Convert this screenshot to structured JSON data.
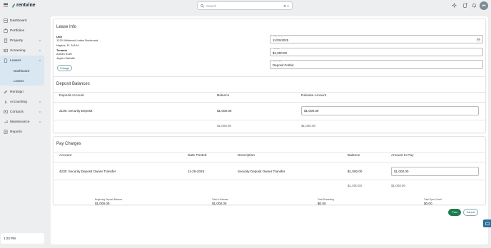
{
  "app": {
    "brand": "rentvine",
    "avatar_initials": "MH"
  },
  "search": {
    "placeholder": "Search",
    "shortcut": "⌘ K"
  },
  "sidebar": {
    "items": [
      {
        "label": "Dashboard",
        "icon": "dashboard-icon"
      },
      {
        "label": "Portfolios",
        "icon": "portfolio-icon"
      },
      {
        "label": "Property",
        "icon": "building-icon"
      },
      {
        "label": "Screening",
        "icon": "screening-icon"
      },
      {
        "label": "Leases",
        "icon": "leases-icon"
      },
      {
        "label": "Rentsign",
        "icon": "sign-icon"
      },
      {
        "label": "Accounting",
        "icon": "dollar-icon"
      },
      {
        "label": "Contacts",
        "icon": "contacts-icon"
      },
      {
        "label": "Maintenance",
        "icon": "wrench-icon"
      },
      {
        "label": "Reports",
        "icon": "reports-icon"
      }
    ],
    "leases_sub": [
      "Dashboard",
      "Leases"
    ],
    "time": "1:23 PM"
  },
  "lease_info": {
    "title": "Lease Info",
    "owner_label": "Unit",
    "address_line1": "1220 Wildwood Lakes Boulevard",
    "address_line2": "Naples, FL 34104",
    "tenants_label": "Tenants",
    "tenant1": "Adrian Soler",
    "tenant2": "Jaylen Waddle",
    "change_label": "Change",
    "date_posted_label": "Date Posted",
    "date_posted": "11/25/2025",
    "amount_label": "Amount",
    "amount": "$1,000.00",
    "description_label": "Description",
    "description": "Deposit Forfeit"
  },
  "deposit_balances": {
    "title": "Deposit Balances",
    "headers": [
      "Deposit Account",
      "Balance",
      "Release Amount"
    ],
    "row": {
      "account": "2100: Security Deposit",
      "balance": "$1,000.00",
      "release": "$1,000.00"
    },
    "totals": {
      "balance": "$1,000.00",
      "release": "$1,000.00"
    }
  },
  "pay_charges": {
    "title": "Pay Charges",
    "headers": [
      "Account",
      "Date Posted",
      "Description",
      "Balance",
      "Amount to Pay"
    ],
    "row": {
      "account": "4230: Security Deposit Owner Transfer",
      "date": "11-25-2025",
      "description": "Security Deposit Owner Transfer",
      "balance": "$1,000.00",
      "amount": "$1,000.00"
    },
    "totals": {
      "balance": "$1,000.00",
      "amount": "$1,000.00"
    }
  },
  "summary": [
    {
      "label": "Beginning Deposit Balance",
      "value": "$1,000.00"
    },
    {
      "label": "Total to Release",
      "value": "$1,000.00"
    },
    {
      "label": "Total Remaining",
      "value": "$0.00"
    },
    {
      "label": "Total Open Credit",
      "value": "$0.00"
    }
  ],
  "actions": {
    "post": "Post",
    "cancel": "Cancel"
  },
  "side_tab": "help"
}
